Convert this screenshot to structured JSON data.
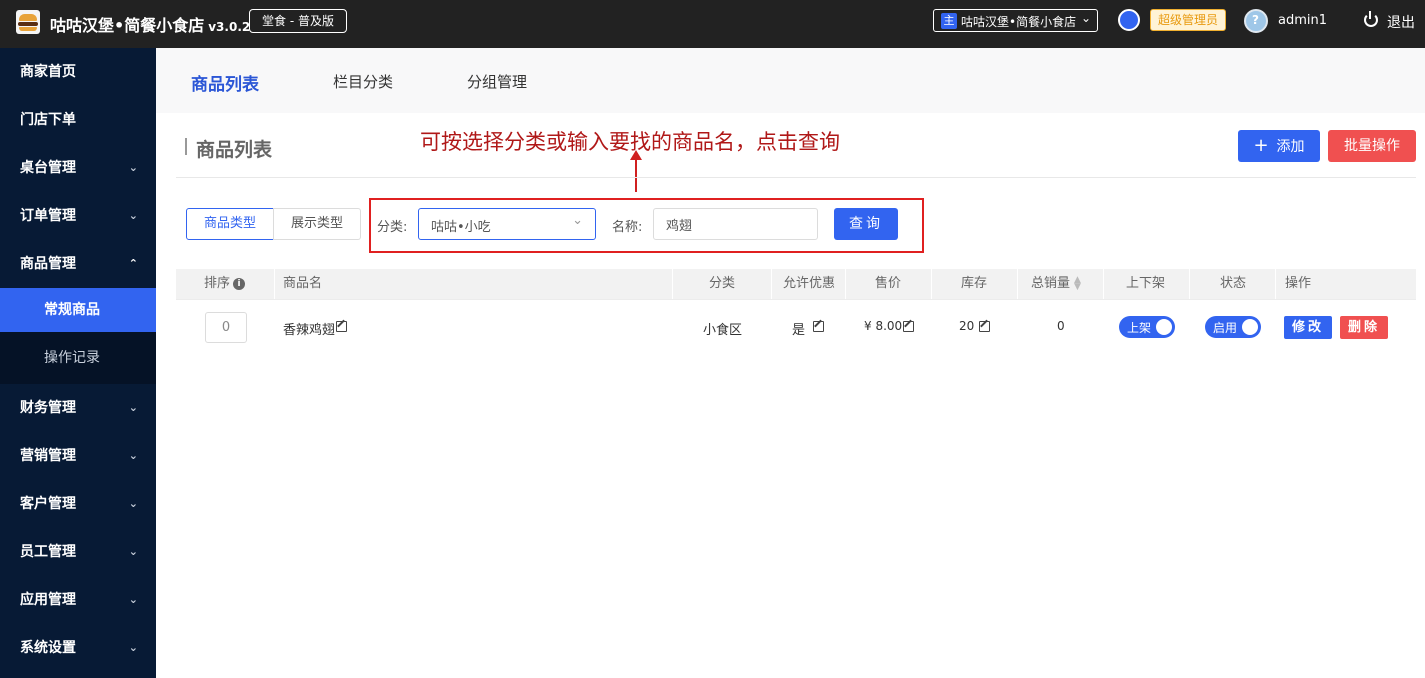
{
  "header": {
    "title": "咕咕汉堡•简餐小食店",
    "version": "v3.0.2",
    "edition": "堂食 - 普及版",
    "store_tag": "主",
    "store_name": "咕咕汉堡•简餐小食店",
    "role_badge": "超级管理员",
    "username": "admin1",
    "logout": "退出",
    "logo_icon": "burger-logo",
    "accent_color": "#3264f0"
  },
  "sidebar": {
    "items": [
      {
        "label": "商家首页"
      },
      {
        "label": "门店下单"
      },
      {
        "label": "桌台管理"
      },
      {
        "label": "订单管理"
      },
      {
        "label": "商品管理"
      },
      {
        "label": "常规商品"
      },
      {
        "label": "操作记录"
      },
      {
        "label": "财务管理"
      },
      {
        "label": "营销管理"
      },
      {
        "label": "客户管理"
      },
      {
        "label": "员工管理"
      },
      {
        "label": "应用管理"
      },
      {
        "label": "系统设置"
      }
    ],
    "background": "#071a35"
  },
  "tabs": [
    {
      "label": "商品列表"
    },
    {
      "label": "栏目分类"
    },
    {
      "label": "分组管理"
    }
  ],
  "page": {
    "title": "商品列表",
    "hint": "可按选择分类或输入要找的商品名，点击查询",
    "add_button": "添加",
    "batch_button": "批量操作"
  },
  "filter": {
    "type_tabs": [
      "商品类型",
      "展示类型"
    ],
    "category_label": "分类:",
    "category_value": "咕咕•小吃",
    "name_label": "名称:",
    "name_value": "鸡翅",
    "query_button": "查询"
  },
  "table": {
    "columns": [
      "排序",
      "商品名",
      "分类",
      "允许优惠",
      "售价",
      "库存",
      "总销量",
      "上下架",
      "状态",
      "操作"
    ],
    "rows": [
      {
        "sort": "0",
        "name": "香辣鸡翅",
        "category": "小食区",
        "discount": "是",
        "price": "¥ 8.00",
        "stock": "20",
        "sales": "0",
        "shelf": "上架",
        "status": "启用",
        "edit": "修改",
        "delete": "删除"
      }
    ]
  }
}
